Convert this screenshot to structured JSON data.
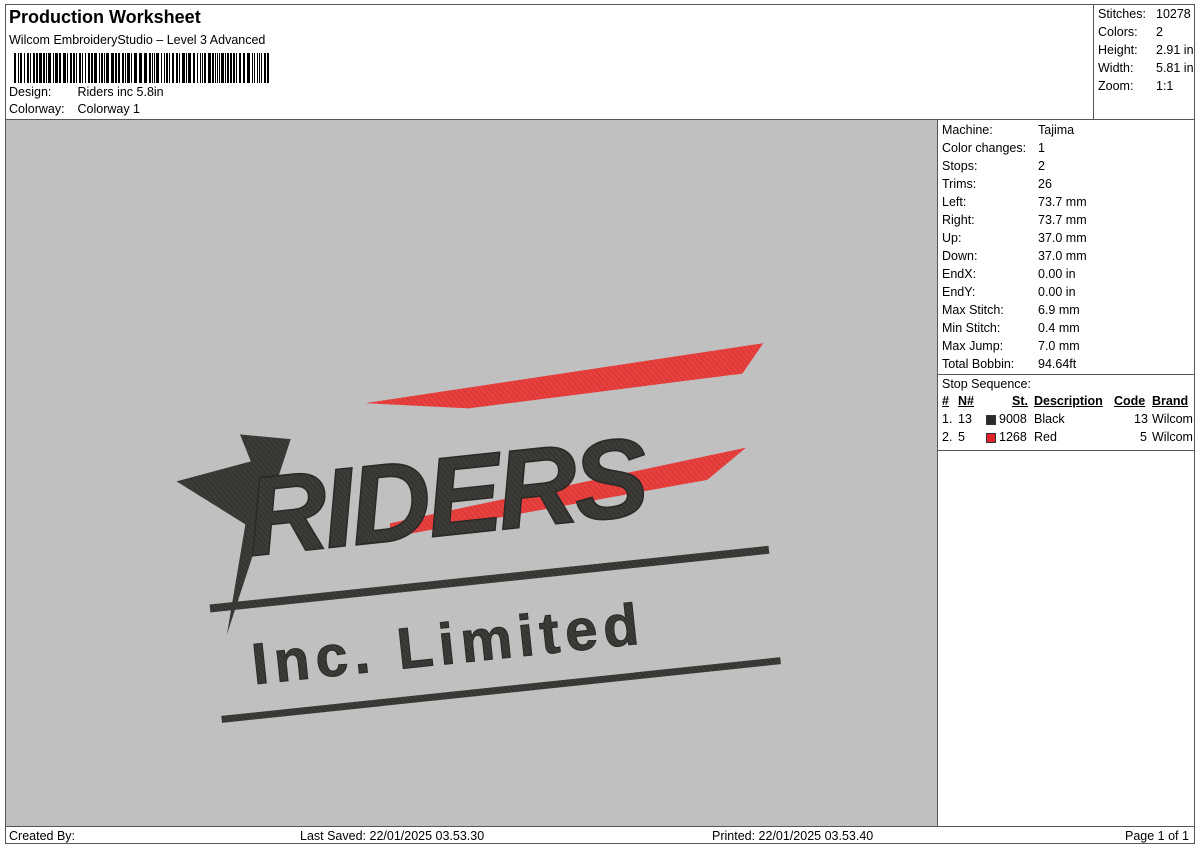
{
  "header": {
    "title": "Production Worksheet",
    "subtitle": "Wilcom EmbroideryStudio – Level 3 Advanced",
    "design_label": "Design:",
    "design_value": "Riders inc 5.8in",
    "colorway_label": "Colorway:",
    "colorway_value": "Colorway 1"
  },
  "summary": [
    {
      "label": "Stitches:",
      "value": "10278"
    },
    {
      "label": "Colors:",
      "value": "2"
    },
    {
      "label": "Height:",
      "value": "2.91 in"
    },
    {
      "label": "Width:",
      "value": "5.81 in"
    },
    {
      "label": "Zoom:",
      "value": "1:1"
    }
  ],
  "machine": [
    {
      "label": "Machine:",
      "value": "Tajima"
    },
    {
      "label": "Color changes:",
      "value": "1"
    },
    {
      "label": "Stops:",
      "value": "2"
    },
    {
      "label": "Trims:",
      "value": "26"
    },
    {
      "label": "Left:",
      "value": "73.7 mm"
    },
    {
      "label": "Right:",
      "value": "73.7 mm"
    },
    {
      "label": "Up:",
      "value": "37.0 mm"
    },
    {
      "label": "Down:",
      "value": "37.0 mm"
    },
    {
      "label": "EndX:",
      "value": "0.00 in"
    },
    {
      "label": "EndY:",
      "value": "0.00 in"
    },
    {
      "label": "Max Stitch:",
      "value": "6.9 mm"
    },
    {
      "label": "Min Stitch:",
      "value": "0.4 mm"
    },
    {
      "label": "Max Jump:",
      "value": "7.0 mm"
    },
    {
      "label": "Total Bobbin:",
      "value": "94.64ft"
    }
  ],
  "stop_sequence": {
    "title": "Stop Sequence:",
    "headers": {
      "num": "#",
      "n": "N#",
      "st": "St.",
      "desc": "Description",
      "code": "Code",
      "brand": "Brand"
    },
    "rows": [
      {
        "num": "1.",
        "n": "13",
        "color": "#2b2b2b",
        "st": "9008",
        "desc": "Black",
        "code": "13",
        "brand": "Wilcom"
      },
      {
        "num": "2.",
        "n": "5",
        "color": "#e0242a",
        "st": "1268",
        "desc": "Red",
        "code": "5",
        "brand": "Wilcom"
      }
    ]
  },
  "design": {
    "main_text": "RIDERS",
    "sub_text": "Inc. Limited",
    "thread_dark": "#3d3b37",
    "thread_red": "#e8403e"
  },
  "footer": {
    "created_by": "Created By:",
    "last_saved": "Last Saved: 22/01/2025 03.53.30",
    "printed": "Printed: 22/01/2025 03.53.40",
    "page": "Page 1 of 1"
  }
}
